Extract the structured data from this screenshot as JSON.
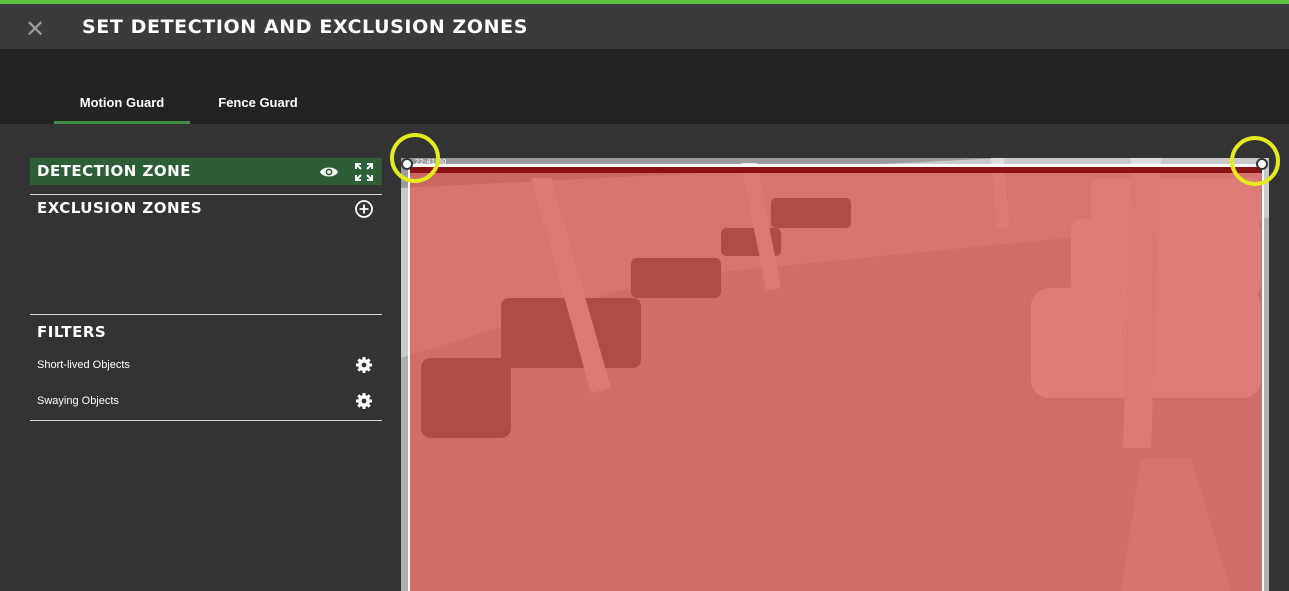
{
  "header": {
    "title": "SET DETECTION AND EXCLUSION ZONES",
    "close_icon": "close-icon"
  },
  "tabs": [
    {
      "label": "Motion Guard",
      "active": true
    },
    {
      "label": "Fence Guard",
      "active": false
    }
  ],
  "sidebar": {
    "detection_zone": {
      "label": "DETECTION ZONE",
      "icons": [
        "eye-icon",
        "expand-icon"
      ]
    },
    "exclusion_zones": {
      "label": "EXCLUSION ZONES",
      "icons": [
        "add-circle-icon"
      ]
    },
    "filters": {
      "label": "FILTERS",
      "items": [
        {
          "label": "Short-lived Objects",
          "icon": "gear-icon"
        },
        {
          "label": "Swaying Objects",
          "icon": "gear-icon"
        }
      ]
    }
  },
  "camera": {
    "timestamp": "22:41:00",
    "overlay_color": "#d9534f",
    "highlight_color": "#e4ea1c"
  },
  "colors": {
    "accent": "#5fbf3a",
    "selected_row": "#2e5e35",
    "tab_underline": "#3f8f3f"
  }
}
